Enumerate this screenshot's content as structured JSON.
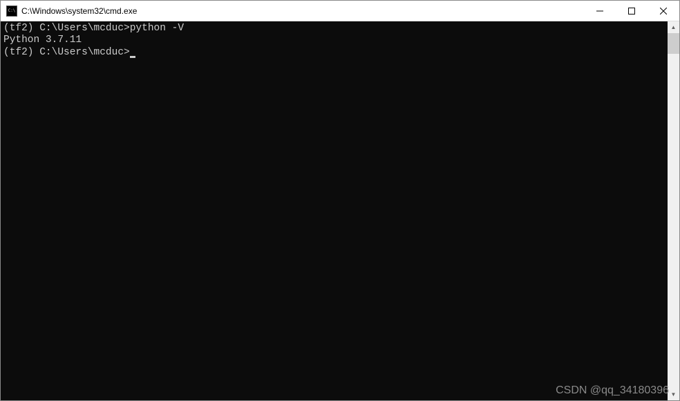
{
  "titlebar": {
    "icon_label": "C:\\",
    "title": "C:\\Windows\\system32\\cmd.exe"
  },
  "terminal": {
    "blank1": "",
    "line1_prompt": "(tf2) C:\\Users\\mcduc>",
    "line1_command": "python -V",
    "line2_output": "Python 3.7.11",
    "blank2": "",
    "line3_prompt": "(tf2) C:\\Users\\mcduc>"
  },
  "watermark": "CSDN @qq_34180396"
}
